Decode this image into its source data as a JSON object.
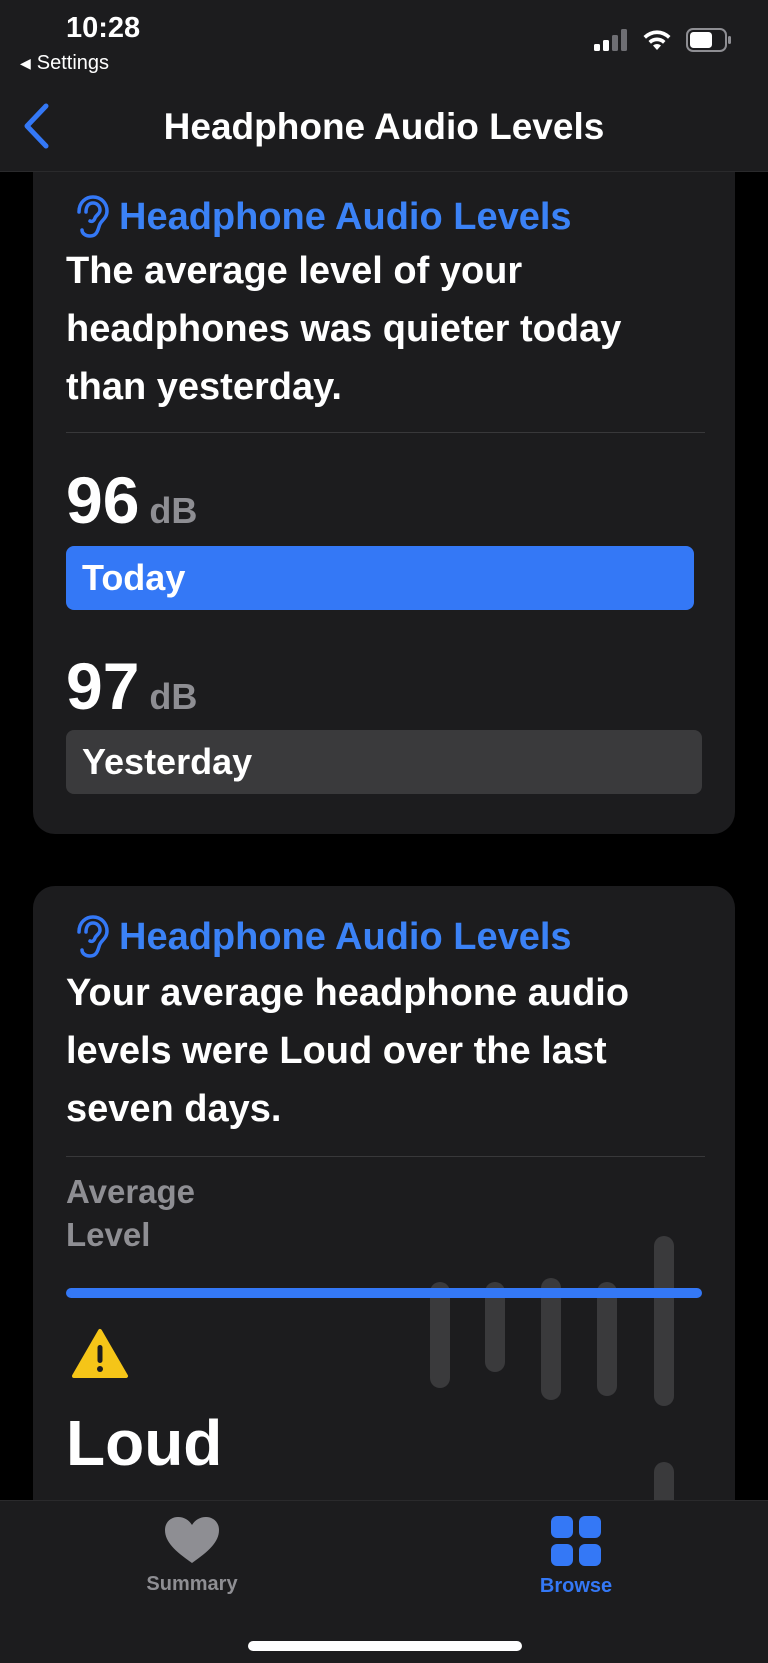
{
  "status_bar": {
    "time": "10:28",
    "back_app": "Settings"
  },
  "nav": {
    "title": "Headphone Audio Levels"
  },
  "card1": {
    "header": "Headphone Audio Levels",
    "text": "The average level of your headphones was quieter today than yesterday.",
    "today_value": "96",
    "today_unit": "dB",
    "today_label": "Today",
    "yesterday_value": "97",
    "yesterday_unit": "dB",
    "yesterday_label": "Yesterday"
  },
  "card2": {
    "header": "Headphone Audio Levels",
    "text": "Your average headphone audio levels were Loud over the last seven days.",
    "avg_label_line1": "Average",
    "avg_label_line2": "Level",
    "status": "Loud"
  },
  "tabs": {
    "summary": "Summary",
    "browse": "Browse"
  },
  "colors": {
    "accent": "#3478f6",
    "card_bg": "#1c1c1e",
    "warning": "#f5c518"
  }
}
